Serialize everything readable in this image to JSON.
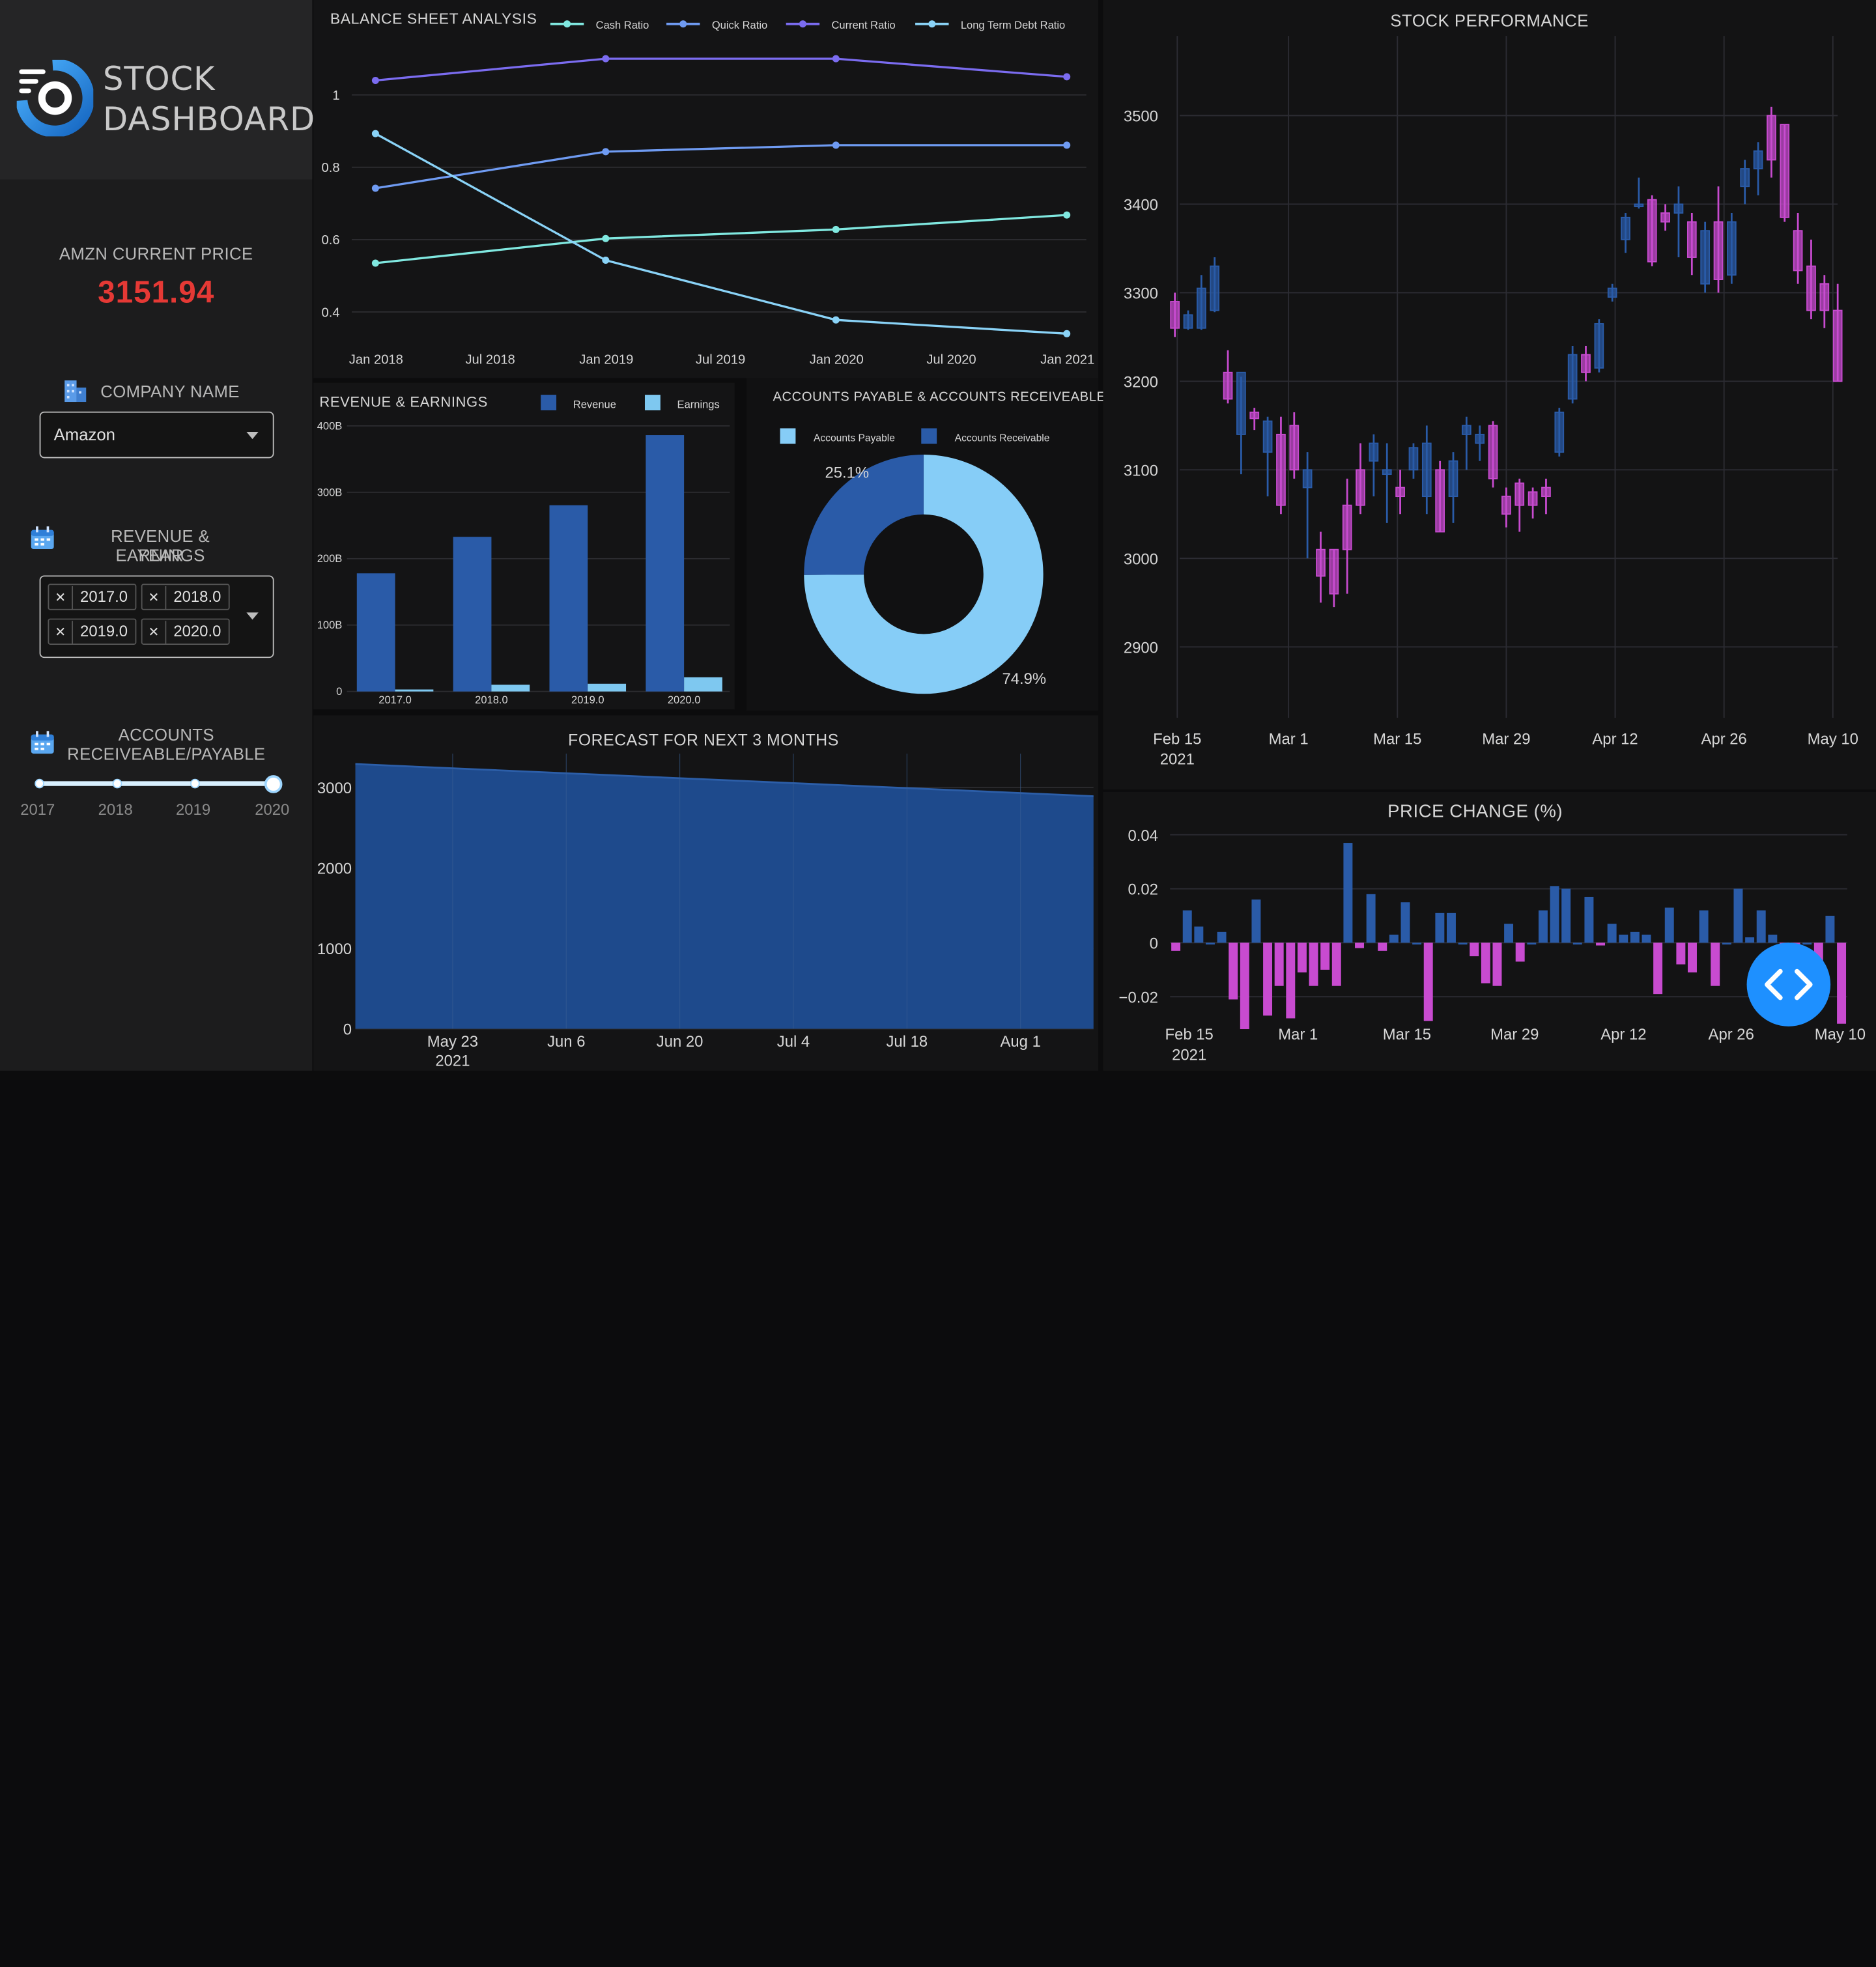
{
  "app": {
    "logo_line1": "STOCK",
    "logo_line2": "DASHBOARD",
    "accent": "#1e90ff"
  },
  "sidebar": {
    "current_price_label": "AMZN CURRENT PRICE",
    "current_price": "3151.94",
    "company_label": "COMPANY NAME",
    "company_icon": "building-icon",
    "company_value": "Amazon",
    "years_label_line1": "REVENUE & EARNINGS",
    "years_label_line2": "YEAR",
    "years_icon": "calendar-icon",
    "years_selected": [
      "2017.0",
      "2018.0",
      "2019.0",
      "2020.0"
    ],
    "ar_label_line1": "ACCOUNTS",
    "ar_label_line2": "RECEIVEABLE/PAYABLE",
    "ar_icon": "calendar-icon",
    "slider_marks": [
      "2017",
      "2018",
      "2019",
      "2020"
    ],
    "slider_value": "2020"
  },
  "balance": {
    "title": "BALANCE SHEET ANALYSIS",
    "legend": [
      "Cash Ratio",
      "Quick Ratio",
      "Current Ratio",
      "Long Term Debt Ratio"
    ]
  },
  "revenue": {
    "title": "REVENUE & EARNINGS",
    "legend": [
      "Revenue",
      "Earnings"
    ]
  },
  "accounts": {
    "title": "ACCOUNTS PAYABLE & ACCOUNTS RECEIVEABLE",
    "legend": [
      "Accounts Payable",
      "Accounts Receivable"
    ]
  },
  "forecast": {
    "title": "FORECAST FOR NEXT 3 MONTHS"
  },
  "stock": {
    "title": "STOCK PERFORMANCE"
  },
  "change": {
    "title": "PRICE CHANGE (%)"
  },
  "fab": {
    "icon": "code-icon"
  },
  "chart_data": [
    {
      "id": "balance",
      "type": "line",
      "title": "BALANCE SHEET ANALYSIS",
      "x": [
        "2017-12-31",
        "2018-12-31",
        "2019-12-31",
        "2020-12-31"
      ],
      "x_ticks": [
        "Jan 2018",
        "Jul 2018",
        "Jan 2019",
        "Jul 2019",
        "Jan 2020",
        "Jul 2020",
        "Jan 2021"
      ],
      "y_ticks": [
        "0.4",
        "0.6",
        "0.8",
        "1"
      ],
      "ylim": [
        0.31,
        1.13
      ],
      "series": [
        {
          "name": "Cash Ratio",
          "color": "#80e8e0",
          "values": [
            0.535,
            0.603,
            0.628,
            0.668
          ]
        },
        {
          "name": "Quick Ratio",
          "color": "#6f9bf2",
          "values": [
            0.742,
            0.843,
            0.861,
            0.861
          ]
        },
        {
          "name": "Current Ratio",
          "color": "#7b6cf0",
          "values": [
            1.04,
            1.1,
            1.1,
            1.05
          ]
        },
        {
          "name": "Long Term Debt Ratio",
          "color": "#8ad3f7",
          "values": [
            0.893,
            0.543,
            0.378,
            0.34
          ]
        }
      ],
      "grid": true,
      "legend": "top"
    },
    {
      "id": "revenue",
      "type": "bar",
      "title": "REVENUE & EARNINGS",
      "categories": [
        "2017.0",
        "2018.0",
        "2019.0",
        "2020.0"
      ],
      "y_ticks": [
        "0",
        "100B",
        "200B",
        "300B",
        "400B"
      ],
      "ylim": [
        0,
        400
      ],
      "series": [
        {
          "name": "Revenue",
          "color": "#2a5ba8",
          "values": [
            177.9,
            232.9,
            280.5,
            386.1
          ]
        },
        {
          "name": "Earnings",
          "color": "#7ec8f0",
          "values": [
            3.0,
            10.1,
            11.6,
            21.3
          ]
        }
      ],
      "legend": "top-right"
    },
    {
      "id": "accounts",
      "type": "pie",
      "title": "ACCOUNTS PAYABLE & ACCOUNTS RECEIVEABLE",
      "labels": [
        "Accounts Payable",
        "Accounts Receivable"
      ],
      "values": [
        74.9,
        25.1
      ],
      "value_labels": [
        "74.9%",
        "25.1%"
      ],
      "colors": [
        "#86cdf7",
        "#2a5ba8"
      ],
      "hole": 0.5,
      "legend": "top"
    },
    {
      "id": "forecast",
      "type": "area",
      "title": "FORECAST FOR NEXT 3 MONTHS",
      "x": [
        "2021-05-11",
        "2021-08-10"
      ],
      "values": [
        3290,
        2890
      ],
      "x_ticks": [
        "May 23\n2021",
        "Jun 6",
        "Jun 20",
        "Jul 4",
        "Jul 18",
        "Aug 1"
      ],
      "y_ticks": [
        "0",
        "1000",
        "2000",
        "3000"
      ],
      "ylim": [
        0,
        3300
      ],
      "color": "#1e4a8c"
    },
    {
      "id": "stock",
      "type": "candlestick",
      "title": "STOCK PERFORMANCE",
      "x_ticks": [
        "Feb 15\n2021",
        "Mar 1",
        "Mar 15",
        "Mar 29",
        "Apr 12",
        "Apr 26",
        "May 10"
      ],
      "y_ticks": [
        "2900",
        "3000",
        "3100",
        "3200",
        "3300",
        "3400",
        "3500"
      ],
      "ylim": [
        2820,
        3590
      ],
      "up_color": "#2a5ba8",
      "down_color": "#c84bd0",
      "candles": [
        [
          3290,
          3300,
          3250,
          3260
        ],
        [
          3260,
          3280,
          3258,
          3275
        ],
        [
          3260,
          3320,
          3258,
          3305
        ],
        [
          3280,
          3340,
          3278,
          3330
        ],
        [
          3210,
          3235,
          3175,
          3180
        ],
        [
          3140,
          3205,
          3095,
          3210
        ],
        [
          3165,
          3170,
          3145,
          3158
        ],
        [
          3120,
          3160,
          3070,
          3155
        ],
        [
          3140,
          3160,
          3050,
          3060
        ],
        [
          3150,
          3165,
          3090,
          3100
        ],
        [
          3080,
          3120,
          3000,
          3100
        ],
        [
          3010,
          3030,
          2950,
          2980
        ],
        [
          3010,
          3010,
          2945,
          2960
        ],
        [
          3060,
          3090,
          2960,
          3010
        ],
        [
          3100,
          3130,
          3050,
          3060
        ],
        [
          3110,
          3140,
          3070,
          3130
        ],
        [
          3095,
          3130,
          3040,
          3100
        ],
        [
          3080,
          3100,
          3050,
          3070
        ],
        [
          3100,
          3130,
          3090,
          3125
        ],
        [
          3070,
          3150,
          3050,
          3130
        ],
        [
          3100,
          3110,
          3030,
          3030
        ],
        [
          3070,
          3120,
          3040,
          3110
        ],
        [
          3140,
          3160,
          3100,
          3150
        ],
        [
          3130,
          3150,
          3110,
          3140
        ],
        [
          3150,
          3155,
          3080,
          3090
        ],
        [
          3070,
          3080,
          3035,
          3050
        ],
        [
          3085,
          3090,
          3030,
          3060
        ],
        [
          3075,
          3080,
          3045,
          3060
        ],
        [
          3080,
          3090,
          3050,
          3070
        ],
        [
          3120,
          3170,
          3115,
          3165
        ],
        [
          3180,
          3240,
          3175,
          3230
        ],
        [
          3230,
          3240,
          3200,
          3210
        ],
        [
          3215,
          3270,
          3210,
          3265
        ],
        [
          3295,
          3310,
          3290,
          3305
        ],
        [
          3360,
          3390,
          3345,
          3385
        ],
        [
          3400,
          3430,
          3395,
          3400
        ],
        [
          3405,
          3410,
          3330,
          3335
        ],
        [
          3390,
          3400,
          3370,
          3380
        ],
        [
          3390,
          3420,
          3340,
          3400
        ],
        [
          3380,
          3390,
          3320,
          3340
        ],
        [
          3310,
          3380,
          3300,
          3370
        ],
        [
          3380,
          3420,
          3300,
          3315
        ],
        [
          3320,
          3390,
          3310,
          3380
        ],
        [
          3420,
          3450,
          3400,
          3440
        ],
        [
          3440,
          3470,
          3410,
          3460
        ],
        [
          3500,
          3510,
          3430,
          3450
        ],
        [
          3490,
          3490,
          3380,
          3385
        ],
        [
          3370,
          3390,
          3310,
          3325
        ],
        [
          3330,
          3360,
          3270,
          3280
        ],
        [
          3310,
          3320,
          3260,
          3280
        ],
        [
          3280,
          3310,
          3200,
          3200
        ]
      ]
    },
    {
      "id": "change",
      "type": "bar",
      "title": "PRICE CHANGE (%)",
      "x_ticks": [
        "Feb 15\n2021",
        "Mar 1",
        "Mar 15",
        "Mar 29",
        "Apr 12",
        "Apr 26",
        "May 10"
      ],
      "y_ticks": [
        "−0.02",
        "0",
        "0.02",
        "0.04"
      ],
      "ylim": [
        -0.031,
        0.047
      ],
      "values": [
        -0.003,
        0.012,
        0.006,
        0.0,
        0.004,
        -0.021,
        -0.032,
        0.016,
        -0.027,
        -0.016,
        -0.028,
        -0.011,
        -0.016,
        -0.01,
        -0.016,
        0.037,
        -0.002,
        0.018,
        -0.003,
        0.003,
        0.015,
        0.0,
        -0.029,
        0.011,
        0.011,
        0.0,
        -0.005,
        -0.015,
        -0.016,
        0.007,
        -0.007,
        0.0,
        0.012,
        0.021,
        0.02,
        0.0,
        0.017,
        -0.001,
        0.007,
        0.003,
        0.004,
        0.003,
        -0.019,
        0.013,
        -0.008,
        -0.011,
        0.012,
        -0.016,
        0.0,
        0.02,
        0.002,
        0.012,
        0.003,
        -0.02,
        -0.018,
        0.0,
        -0.013,
        0.01,
        -0.03
      ]
    }
  ]
}
